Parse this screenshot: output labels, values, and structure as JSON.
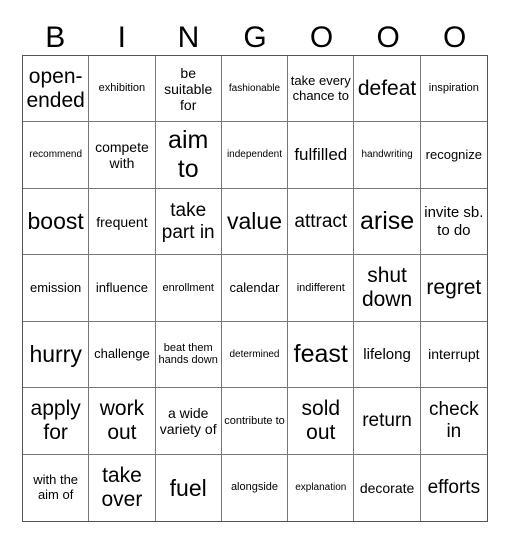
{
  "header": {
    "letters": [
      "B",
      "I",
      "N",
      "G",
      "O",
      "O",
      "O"
    ]
  },
  "cells": [
    "open-ended",
    "exhibition",
    "be suitable for",
    "fashionable",
    "take every chance to",
    "defeat",
    "inspiration",
    "recommend",
    "compete with",
    "aim to",
    "independent",
    "fulfilled",
    "handwriting",
    "recognize",
    "boost",
    "frequent",
    "take part in",
    "value",
    "attract",
    "arise",
    "invite sb. to do",
    "emission",
    "influence",
    "enrollment",
    "calendar",
    "indifferent",
    "shut down",
    "regret",
    "hurry",
    "challenge",
    "beat them hands down",
    "determined",
    "feast",
    "lifelong",
    "interrupt",
    "apply for",
    "work out",
    "a wide variety of",
    "contribute to",
    "sold out",
    "return",
    "check in",
    "with the aim of",
    "take over",
    "fuel",
    "alongside",
    "explanation",
    "decorate",
    "efforts"
  ]
}
